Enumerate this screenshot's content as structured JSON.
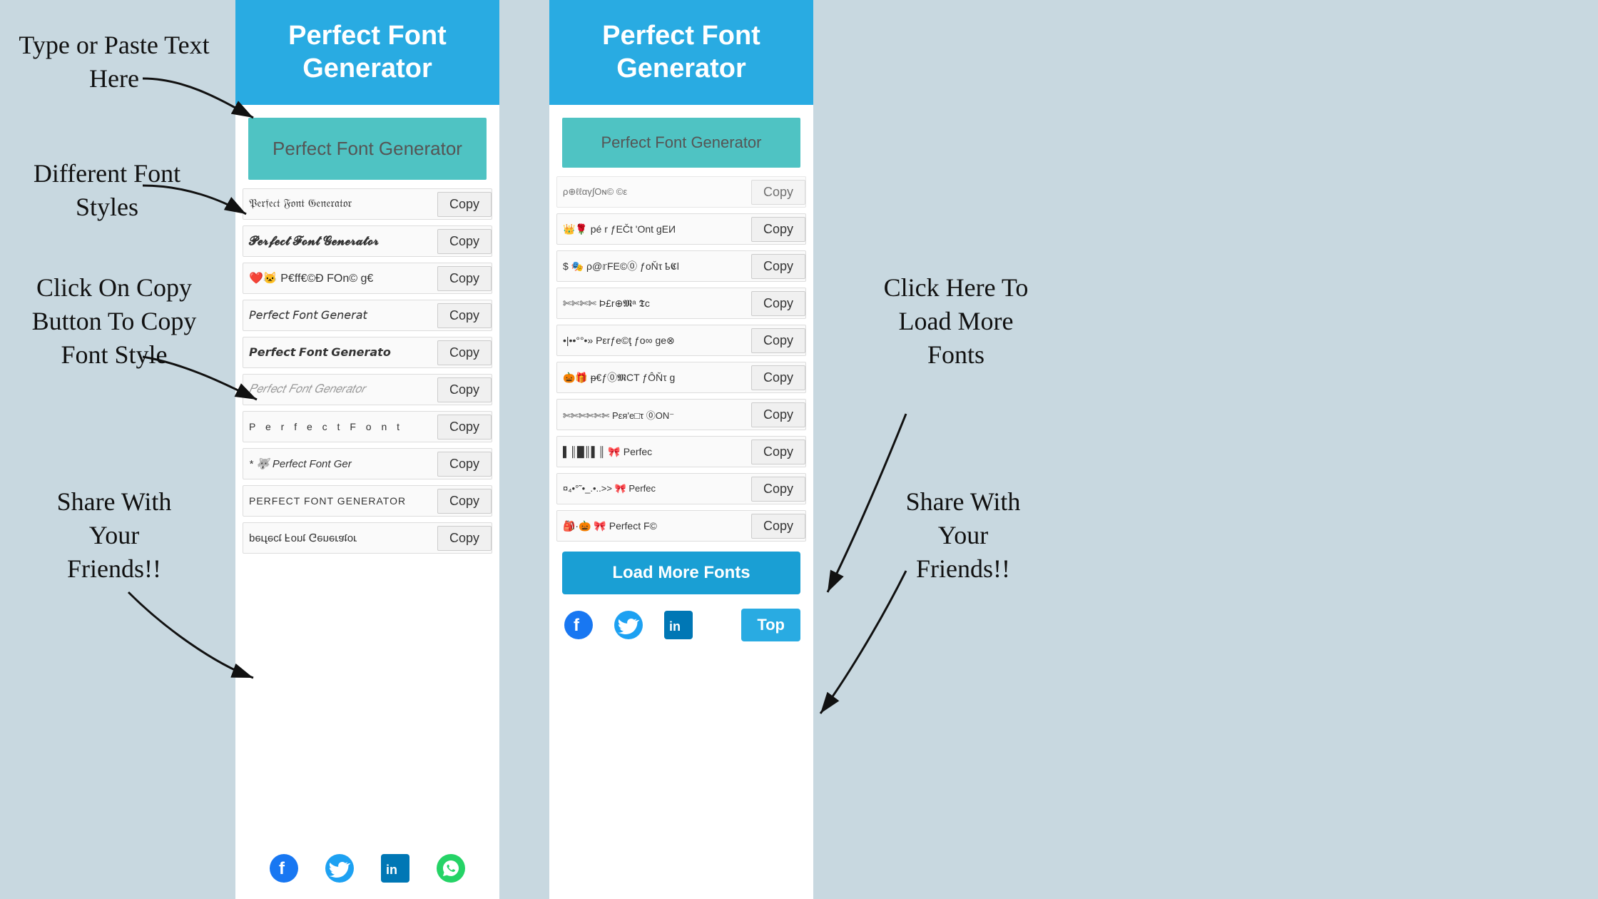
{
  "app": {
    "title": "Perfect Font Generator",
    "background": "#c8d8e0"
  },
  "annotations": {
    "type_here": "Type or Paste Text\nHere",
    "different_styles": "Different Font\nStyles",
    "click_copy": "Click On Copy\nButton To Copy\nFont Style",
    "share_friends_left": "Share With\nYour\nFriends!!",
    "click_load_more": "Click Here To\nLoad More\nFonts",
    "share_friends_right": "Share With\nYour\nFriends!!"
  },
  "left_panel": {
    "header": "Perfect Font Generator",
    "input_placeholder": "Perfect Font Generator",
    "input_value": "Perfect Font Generator",
    "fonts": [
      {
        "text": "𝔓𝔢𝔯𝔣𝔢𝔠𝔱 𝔉𝔬𝔫𝔱 𝔊𝔢𝔫𝔢𝔯𝔞𝔱𝔬𝔯",
        "copy": "Copy"
      },
      {
        "text": "𝓟𝓮𝓻𝓯𝓮𝓬𝓽 𝓕𝓸𝓷𝓽 𝓖𝓮𝓷𝓮𝓻𝓪𝓽𝓸𝓻",
        "copy": "Copy"
      },
      {
        "text": "❤️🐱 P€ff€©D FOn© g€",
        "copy": "Copy"
      },
      {
        "text": "𝘗𝘦𝘳𝘧𝘦𝘤𝘵 𝘍𝘰𝘯𝘵 𝘎𝘦𝘯𝘦𝘳𝘢𝘵",
        "copy": "Copy"
      },
      {
        "text": "𝙋𝙚𝙧𝙛𝙚𝙘𝙩 𝙁𝙤𝙣𝙩 𝙂𝙚𝙣𝙚𝙧𝙖𝙩𝙤",
        "copy": "Copy"
      },
      {
        "text": "𝑃𝑒𝑟𝑓𝑒𝑐𝑡 𝐹𝑜𝑛𝑡 𝐺𝑒𝑛𝑒𝑟𝑎𝑡𝑜𝑟",
        "copy": "Copy"
      },
      {
        "text": "P e r f e c t  F o n t",
        "copy": "Copy",
        "spaced": true
      },
      {
        "text": "* 🐺 Perfect Font Ger",
        "copy": "Copy"
      },
      {
        "text": "PERFECT FONT GENERATOR",
        "copy": "Copy"
      },
      {
        "text": "ɹoʇɐɹǝuǝ⅁ ʇuoℲ ʇɔǝɟɹǝd",
        "copy": "Copy"
      }
    ],
    "social": [
      "facebook",
      "twitter",
      "linkedin",
      "whatsapp"
    ]
  },
  "right_panel": {
    "header": "Perfect Font Generator",
    "input_value": "Perfect Font Generator",
    "fonts": [
      {
        "text": "ρє𝔯ƒεcт 𝔣Ont gEИ",
        "copy": "Copy"
      },
      {
        "text": "$ 𝔐 ρ@𝕣FE©⓪ ƒoŇτ ҍ𝕮l",
        "copy": "Copy"
      },
      {
        "text": "✄✄✄✄ Þ£r⊕𝕸ᵃ 𝕿c",
        "copy": "Copy"
      },
      {
        "text": "•|••°°•» Pεrƒe©ţ ƒo∞ ge⊗",
        "copy": "Copy"
      },
      {
        "text": "🎃🎁 ᵽ€ƒ⓪𝕸CT ƒÔŇτ g",
        "copy": "Copy"
      },
      {
        "text": "✄✄✄✄✄✄ Pεя'e□τ ⓪ON⁻",
        "copy": "Copy"
      },
      {
        "text": "▌║█║▌║ 🎀 Perfec",
        "copy": "Copy"
      },
      {
        "text": "¤₄•°˜•_.•..>>  🎀 Perfec",
        "copy": "Copy"
      },
      {
        "text": "🎒·🎃 🎀 Perfect F©",
        "copy": "Copy"
      }
    ],
    "load_more": "Load More Fonts",
    "top_btn": "Top",
    "social": [
      "facebook",
      "twitter",
      "linkedin"
    ]
  },
  "social_icons": {
    "facebook": "f",
    "twitter": "🐦",
    "linkedin": "in",
    "whatsapp": "📱"
  },
  "colors": {
    "header_bg": "#29abe2",
    "input_bg": "#4fc3c3",
    "load_more_bg": "#1a9fd4",
    "top_btn_bg": "#29abe2"
  }
}
